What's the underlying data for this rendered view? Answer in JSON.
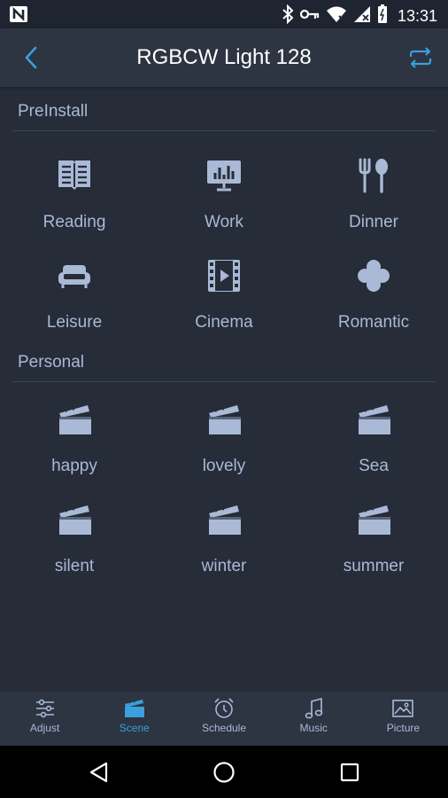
{
  "status": {
    "time": "13:31"
  },
  "header": {
    "title": "RGBCW Light 128"
  },
  "preinstall": {
    "title": "PreInstall",
    "items": [
      {
        "label": "Reading",
        "icon": "book-icon"
      },
      {
        "label": "Work",
        "icon": "monitor-chart-icon"
      },
      {
        "label": "Dinner",
        "icon": "fork-spoon-icon"
      },
      {
        "label": "Leisure",
        "icon": "sofa-icon"
      },
      {
        "label": "Cinema",
        "icon": "film-icon"
      },
      {
        "label": "Romantic",
        "icon": "clover-icon"
      }
    ]
  },
  "personal": {
    "title": "Personal",
    "items": [
      {
        "label": "happy",
        "icon": "clapperboard-icon"
      },
      {
        "label": "lovely",
        "icon": "clapperboard-icon"
      },
      {
        "label": "Sea",
        "icon": "clapperboard-icon"
      },
      {
        "label": "silent",
        "icon": "clapperboard-icon"
      },
      {
        "label": "winter",
        "icon": "clapperboard-icon"
      },
      {
        "label": "summer",
        "icon": "clapperboard-icon"
      }
    ]
  },
  "tabs": [
    {
      "label": "Adjust",
      "icon": "sliders-icon",
      "active": false
    },
    {
      "label": "Scene",
      "icon": "clapperboard-icon",
      "active": true
    },
    {
      "label": "Schedule",
      "icon": "alarm-clock-icon",
      "active": false
    },
    {
      "label": "Music",
      "icon": "music-note-icon",
      "active": false
    },
    {
      "label": "Picture",
      "icon": "picture-icon",
      "active": false
    }
  ],
  "colors": {
    "accent": "#3aa0de",
    "icon": "#a9b9d6",
    "background": "#262c38",
    "bar": "#2d3442"
  }
}
